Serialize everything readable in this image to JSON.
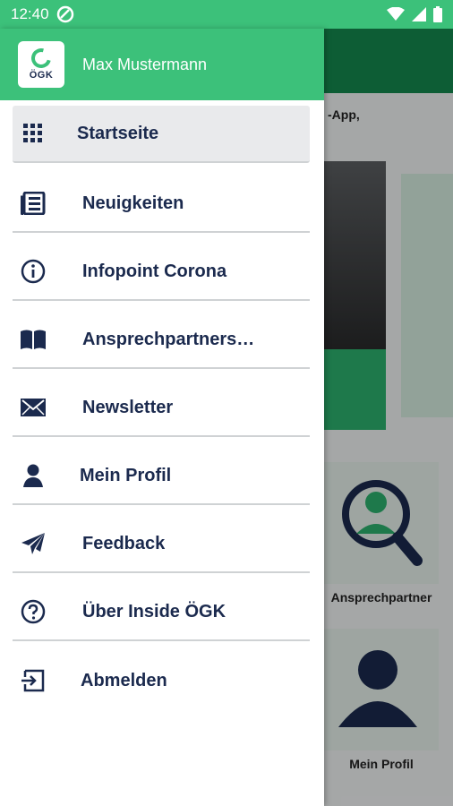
{
  "status_bar": {
    "time": "12:40"
  },
  "background_page": {
    "snippet": "-App,",
    "tiles": [
      {
        "label": "Ansprechpartner"
      },
      {
        "label": "Mein Profil"
      }
    ]
  },
  "drawer": {
    "logo_text": "ÖGK",
    "user_name": "Max Mustermann",
    "items": [
      {
        "label": "Startseite",
        "icon": "grid-icon",
        "active": true
      },
      {
        "label": "Neuigkeiten",
        "icon": "newspaper-icon"
      },
      {
        "label": "Infopoint Corona",
        "icon": "info-icon"
      },
      {
        "label": "Ansprechpartners…",
        "icon": "book-icon"
      },
      {
        "label": "Newsletter",
        "icon": "envelope-icon"
      },
      {
        "label": "Mein Profil",
        "icon": "person-icon"
      },
      {
        "label": "Feedback",
        "icon": "paper-plane-icon"
      },
      {
        "label": "Über Inside ÖGK",
        "icon": "help-icon"
      },
      {
        "label": "Abmelden",
        "icon": "logout-icon"
      }
    ]
  },
  "colors": {
    "brand_green": "#3cc17a",
    "text_navy": "#1b2a4e"
  }
}
